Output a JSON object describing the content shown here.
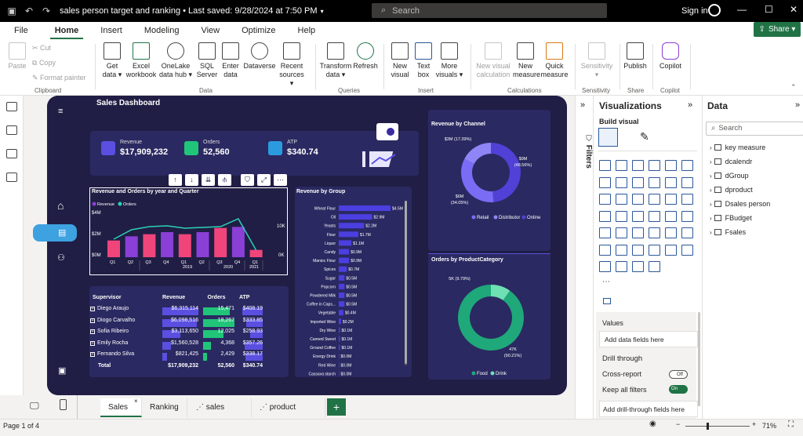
{
  "titlebar": {
    "title": "sales person target and ranking • Last saved: 9/28/2024 at 7:50 PM",
    "search_placeholder": "Search",
    "signin": "Sign in"
  },
  "menu": [
    "File",
    "Home",
    "Insert",
    "Modeling",
    "View",
    "Optimize",
    "Help"
  ],
  "share": "Share",
  "ribbon": {
    "paste": "Paste",
    "cut": "Cut",
    "copy": "Copy",
    "format_painter": "Format painter",
    "buttons": [
      {
        "l1": "Get",
        "l2": "data ▾"
      },
      {
        "l1": "Excel",
        "l2": "workbook"
      },
      {
        "l1": "OneLake",
        "l2": "data hub ▾"
      },
      {
        "l1": "SQL",
        "l2": "Server"
      },
      {
        "l1": "Enter",
        "l2": "data"
      },
      {
        "l1": "Dataverse",
        "l2": ""
      },
      {
        "l1": "Recent",
        "l2": "sources ▾"
      },
      {
        "l1": "Transform",
        "l2": "data ▾"
      },
      {
        "l1": "Refresh",
        "l2": ""
      },
      {
        "l1": "New",
        "l2": "visual"
      },
      {
        "l1": "Text",
        "l2": "box"
      },
      {
        "l1": "More",
        "l2": "visuals ▾"
      },
      {
        "l1": "New visual",
        "l2": "calculation"
      },
      {
        "l1": "New",
        "l2": "measure"
      },
      {
        "l1": "Quick",
        "l2": "measure"
      },
      {
        "l1": "Sensitivity",
        "l2": "▾"
      },
      {
        "l1": "Publish",
        "l2": ""
      },
      {
        "l1": "Copilot",
        "l2": ""
      }
    ],
    "groups": [
      "Clipboard",
      "Data",
      "Queries",
      "Insert",
      "Calculations",
      "Sensitivity",
      "Share",
      "Copilot"
    ]
  },
  "dashboard": {
    "title": "Sales Dashboard",
    "kpis": [
      {
        "label": "Revenue",
        "value": "$17,909,232",
        "color": "#5a4fe0"
      },
      {
        "label": "Orders",
        "value": "52,560",
        "color": "#21c57a"
      },
      {
        "label": "ATP",
        "value": "$340.74",
        "color": "#2b9be0"
      }
    ],
    "combo": {
      "title": "Revenue and Orders by year and Quarter",
      "legend": [
        "Revenue",
        "Orders"
      ],
      "y_left": [
        "$4M",
        "$2M",
        "$0M"
      ],
      "y_right": [
        "10K",
        "0K"
      ],
      "quarters": [
        "Q1",
        "Q2",
        "Q3",
        "Q4",
        "Q1",
        "Q2",
        "Q3",
        "Q4",
        "Q1"
      ],
      "years": [
        "2019",
        "2020",
        "2021"
      ]
    },
    "group_title": "Revenue by Group",
    "channel_title": "Revenue by Channel",
    "category_title": "Orders by ProductCategory",
    "table": {
      "headers": [
        "Supervisor",
        "Revenue",
        "Orders",
        "ATP"
      ],
      "rows": [
        [
          "Diego Araujo",
          "$6,315,114",
          "15,471",
          "$408.19"
        ],
        [
          "Diogo Carvalho",
          "$6,098,516",
          "18,267",
          "$333.85"
        ],
        [
          "Sofia Ribeiro",
          "$3,113,650",
          "12,025",
          "$258.93"
        ],
        [
          "Emily Rocha",
          "$1,560,528",
          "4,368",
          "$357.26"
        ],
        [
          "Fernando Silva",
          "$821,425",
          "2,429",
          "$338.17"
        ]
      ],
      "total": [
        "Total",
        "$17,909,232",
        "52,560",
        "$340.74"
      ]
    }
  },
  "chart_data": [
    {
      "type": "bar",
      "title": "Revenue and Orders by year and Quarter",
      "categories": [
        "2019 Q1",
        "2019 Q2",
        "2019 Q3",
        "2019 Q4",
        "2020 Q1",
        "2020 Q2",
        "2020 Q3",
        "2020 Q4",
        "2021 Q1"
      ],
      "series": [
        {
          "name": "Revenue",
          "values": [
            1.6,
            2.0,
            2.2,
            2.4,
            2.2,
            2.4,
            2.8,
            2.9,
            0.7
          ]
        },
        {
          "name": "Orders",
          "values": [
            4600,
            7000,
            7800,
            8000,
            7400,
            7600,
            7800,
            9800,
            1800
          ]
        }
      ],
      "ylim": [
        0,
        4.5
      ],
      "colors": [
        "#f0457a",
        "#8a3fd6",
        "#f0457a",
        "#8a3fd6",
        "#f0457a",
        "#8a3fd6",
        "#f0457a",
        "#8a3fd6",
        "#f0457a"
      ],
      "line_color": "#2bd1b5"
    },
    {
      "type": "bar",
      "title": "Revenue by Group",
      "categories": [
        "Wheat Flour",
        "Oil",
        "Yeasts",
        "Flour",
        "Liquor",
        "Candy",
        "Manioc Flour",
        "Spices",
        "Sugar",
        "Popcorn",
        "Powdered Milk",
        "Coffee in Caps...",
        "Vegetable",
        "Imported Wine",
        "Dry Wine",
        "Canned Sweet",
        "Ground Coffee",
        "Energy Drink",
        "Red Wine",
        "Cassava starch"
      ],
      "values": [
        4.5,
        2.9,
        2.2,
        1.7,
        1.1,
        0.9,
        0.9,
        0.7,
        0.5,
        0.5,
        0.5,
        0.5,
        0.4,
        0.2,
        0.1,
        0.1,
        0.1,
        0.0,
        0.0,
        0.0
      ],
      "labels": [
        "$4.5M",
        "$2.9M",
        "$2.2M",
        "$1.7M",
        "$1.1M",
        "$0.9M",
        "$0.9M",
        "$0.7M",
        "$0.5M",
        "$0.5M",
        "$0.5M",
        "$0.5M",
        "$0.4M",
        "$0.2M",
        "$0.1M",
        "$0.1M",
        "$0.1M",
        "$0.0M",
        "$0.0M",
        "$0.0M"
      ]
    },
    {
      "type": "pie",
      "title": "Revenue by Channel",
      "categories": [
        "Retail",
        "Distributor",
        "Online"
      ],
      "values": [
        34.05,
        17.39,
        48.56
      ],
      "labels": [
        "$6M\n(34.05%)",
        "$3M (17.39%)",
        "$9M\n(48.56%)"
      ],
      "colors": [
        "#7b6cf6",
        "#8e86f7",
        "#5141d6"
      ]
    },
    {
      "type": "pie",
      "title": "Orders by ProductCategory",
      "categories": [
        "Food",
        "Drink"
      ],
      "values": [
        90.21,
        9.79
      ],
      "labels": [
        "47K\n(90.21%)",
        "5K (9.79%)"
      ],
      "colors": [
        "#1fa87a",
        "#6fe0b4"
      ]
    }
  ],
  "viz": {
    "title": "Visualizations",
    "build_visual": "Build visual",
    "filters": "Filters",
    "values": "Values",
    "add_data": "Add data fields here",
    "drill": "Drill through",
    "cross_report": "Cross-report",
    "cross_state": "Off",
    "keep_filters": "Keep all filters",
    "keep_state": "On",
    "add_drill": "Add drill-through fields here"
  },
  "data_panel": {
    "title": "Data",
    "search": "Search",
    "items": [
      "key measure",
      "dcalendr",
      "dGroup",
      "dproduct",
      "Dsales person",
      "FBudget",
      "Fsales"
    ]
  },
  "tabs": [
    "Sales",
    "Ranking",
    "sales tooltip",
    "product Tooltip"
  ],
  "status": {
    "page": "Page 1 of 4",
    "zoom": "71%"
  }
}
